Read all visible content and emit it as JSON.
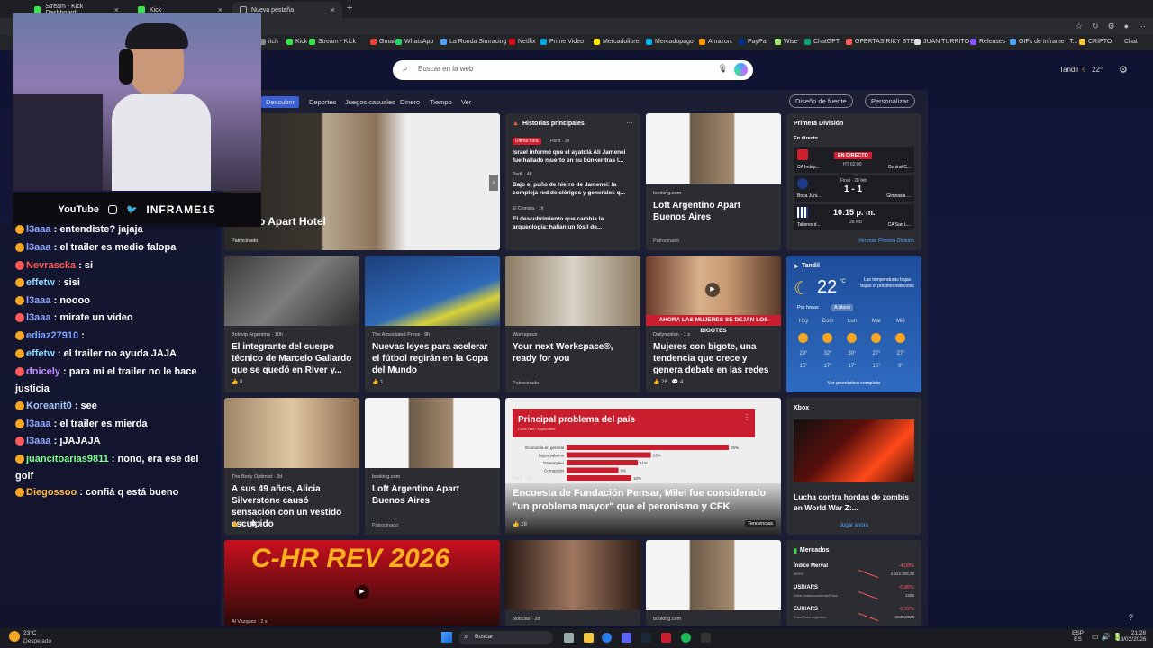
{
  "tabs": [
    {
      "label": "Stream - Kick Dashboard"
    },
    {
      "label": "Kick"
    },
    {
      "label": "Nueva pestaña"
    }
  ],
  "bookmarks": [
    "itch",
    "Kick",
    "Stream - Kick",
    "Gmail",
    "WhatsApp",
    "La Ronda Simracing",
    "Netflix",
    "Prime Video",
    "Mercadolibre",
    "Mercadopago",
    "Amazon.",
    "PayPal",
    "Wise",
    "ChatGPT",
    "OFERTAS RIKY STE...",
    "JUAN TURRITO",
    "Releases",
    "GIFs de Inframe | T...",
    "CRIPTO"
  ],
  "bookmarks_right": "Chat",
  "overlay": {
    "youtube": "YouTube",
    "handle": "INFRAME15"
  },
  "chat": [
    {
      "user": "l3aaa",
      "color": "#8fa8ff",
      "text": ": entendiste? jajaja"
    },
    {
      "user": "l3aaa",
      "color": "#8fa8ff",
      "text": ": el trailer es medio falopa"
    },
    {
      "user": "Nevrascka",
      "color": "#ff5a5a",
      "text": ": si"
    },
    {
      "user": "effetw",
      "color": "#8fd8ff",
      "text": ": sisi"
    },
    {
      "user": "l3aaa",
      "color": "#8fa8ff",
      "text": ": noooo"
    },
    {
      "user": "l3aaa",
      "color": "#8fa8ff",
      "text": ": mirate un video"
    },
    {
      "user": "ediaz27910",
      "color": "#7ea0ff",
      "text": ":"
    },
    {
      "user": "effetw",
      "color": "#8fd8ff",
      "text": ": el trailer no ayuda JAJA"
    },
    {
      "user": "dnicely",
      "color": "#c08aff",
      "text": ": para mi el trailer no le hace justicia"
    },
    {
      "user": "Koreanit0",
      "color": "#a8c8ff",
      "text": ": see"
    },
    {
      "user": "l3aaa",
      "color": "#8fa8ff",
      "text": ": el trailer es mierda"
    },
    {
      "user": "l3aaa",
      "color": "#8fa8ff",
      "text": ": jJAJAJA"
    },
    {
      "user": "juancitoarias9811",
      "color": "#7dff8a",
      "text": ": nono, era ese del golf"
    },
    {
      "user": "Diegossoo",
      "color": "#ffb84a",
      "text": ": confiá q está bueno"
    }
  ],
  "search": {
    "placeholder": "Buscar en la web"
  },
  "weather_header": {
    "city": "Tandil",
    "temp": "22°"
  },
  "nav": {
    "tabs": [
      "Descubrir",
      "Deportes",
      "Juegos casuales",
      "Dinero",
      "Tiempo",
      "Ver"
    ],
    "font_btn": "Diseño de fuente",
    "personalize": "Personalizar"
  },
  "hero": {
    "title": "o Apart Hotel",
    "sponsor": "Patrocinado"
  },
  "top_stories": {
    "header": "Historias principales",
    "items": [
      {
        "tag": "Última hora",
        "source": "Perfil · 3h",
        "title": "Israel informó que el ayatolá Alí Jamenei fue hallado muerto en su búnker tras l..."
      },
      {
        "source": "Perfil · 4h",
        "title": "Bajo el puño de hierro de Jamenei: la compleja red de clérigos y generales q..."
      },
      {
        "source": "El Cronista · 1h",
        "title": "El descubrimiento que cambia la arqueología: hallan un fósil de..."
      }
    ]
  },
  "loft1": {
    "source": "booking.com",
    "title": "Loft Argentino Apart Buenos Aires",
    "sponsor": "Patrocinado"
  },
  "sports": {
    "header": "Primera División",
    "live": "En directo",
    "m1": {
      "home": "CA Indep...",
      "status": "EN DIRECTO",
      "clock": "HT 62:00",
      "away": "Central C..."
    },
    "m2": {
      "home": "Boca Juni...",
      "status": "Final · 28 feb",
      "score": "1 - 1",
      "away": "Gimnasia ..."
    },
    "m3": {
      "home": "Talleres d...",
      "time": "10:15 p. m.",
      "date": "28 feb",
      "away": "CA San L..."
    },
    "more": "Ver más Primera División"
  },
  "card2": [
    {
      "source": "Bolavip Argentina · 10h",
      "title": "El integrante del cuerpo técnico de Marcelo Gallardo que se quedó en River y...",
      "likes": "8"
    },
    {
      "source": "The Associated Press · 9h",
      "title": "Nuevas leyes para acelerar el fútbol regirán en la Copa del Mundo",
      "likes": "1"
    },
    {
      "source": "Workspace",
      "title": "Your next Workspace®, ready for you",
      "sponsor": "Patrocinado"
    },
    {
      "source": "Dailymotion · 1 s",
      "title": "Mujeres con bigote, una tendencia que crece y genera debate en las redes",
      "likes": "26",
      "comments": "4",
      "caption": "AHORA LAS MUJERES SE DEJAN LOS BIGOTES"
    }
  ],
  "weather": {
    "city": "Tandil",
    "temp": "22",
    "unit": "°C",
    "note": "Las temperaturas bajas bajan el próximo miércoles",
    "tabs": [
      "Por horas",
      "A diario"
    ],
    "days": [
      {
        "d": "Hoy",
        "hi": "29°",
        "lo": "15°"
      },
      {
        "d": "Dom",
        "hi": "32°",
        "lo": "17°"
      },
      {
        "d": "Lun",
        "hi": "30°",
        "lo": "17°"
      },
      {
        "d": "Mar",
        "hi": "27°",
        "lo": "15°"
      },
      {
        "d": "Mié",
        "hi": "27°",
        "lo": "9°"
      }
    ],
    "more": "Ver pronóstico completo"
  },
  "card3": [
    {
      "source": "The Body Optimist · 2d",
      "title": "A sus 49 años, Alicia Silverstone causó sensación con un vestido esculpido",
      "likes": "32",
      "comments": "1"
    },
    {
      "source": "booking.com",
      "title": "Loft Argentino Apart Buenos Aires",
      "sponsor": "Patrocinado"
    }
  ],
  "poll": {
    "title": "Principal problema del país",
    "subtitle": "Cuna Test / Septiembre",
    "headline": "Encuesta de Fundación Pensar, Milei fue considerado \"un problema mayor\" que el peronismo y CFK",
    "source": "Perfil · 22h",
    "likes": "28",
    "trend": "Tendencias",
    "bars": [
      {
        "label": "Economía en general",
        "value": 25,
        "pct": "25%"
      },
      {
        "label": "Bajos salarios",
        "value": 13,
        "pct": "13%"
      },
      {
        "label": "Desempleo",
        "value": 11,
        "pct": "11%"
      },
      {
        "label": "Corrupción",
        "value": 8,
        "pct": "8%"
      },
      {
        "label": "",
        "value": 10,
        "pct": "10%"
      }
    ]
  },
  "xbox": {
    "header": "Xbox",
    "title": "Lucha contra hordas de zombis en World War Z:...",
    "cta": "Jugar ahora"
  },
  "card4": [
    {
      "caption": "C-HR REV 2026",
      "source": "Al Vazquez · 2 s"
    },
    {
      "source": "Noticias · 2d"
    },
    {
      "source": "booking.com"
    }
  ],
  "markets": {
    "header": "Mercados",
    "rows": [
      {
        "name": "Índice Merval",
        "sub": "MERV",
        "change": "-4,08%",
        "value": "2.642.305,38"
      },
      {
        "name": "USD/ARS",
        "sub": "Dólar estadounidense/Peso",
        "change": "-0,85%",
        "value": "1396"
      },
      {
        "name": "EUR/ARS",
        "sub": "Euro/Peso argentino",
        "change": "-0,72%",
        "value": "1649,0948"
      }
    ]
  },
  "taskbar": {
    "temp": "23°C",
    "cond": "Despejado",
    "search": "Buscar",
    "lang": "ESP",
    "lang2": "ES",
    "time": "21:28",
    "date": "28/02/2026"
  },
  "colors": {
    "accent": "#4fa3ff",
    "negative": "#ff5a5a",
    "poll_red": "#c81e2d"
  }
}
